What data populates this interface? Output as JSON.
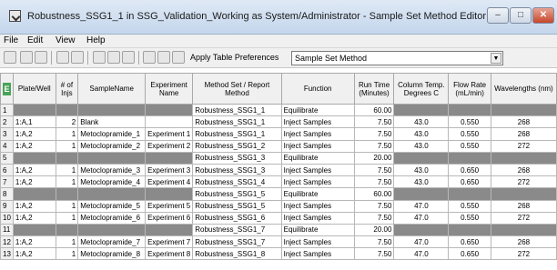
{
  "window": {
    "title": "Robustness_SSG1_1 in SSG_Validation_Working as System/Administrator - Sample Set Method Editor",
    "minimize": "–",
    "maximize": "□",
    "close": "✕"
  },
  "menu": [
    "File",
    "Edit",
    "View",
    "Help"
  ],
  "toolbar": {
    "apply_label": "Apply Table Preferences",
    "preference_value": "Sample Set Method",
    "dropdown_icon": "▼"
  },
  "table": {
    "corner": "E",
    "headers": [
      "Plate/Well",
      "# of Injs",
      "SampleName",
      "Experiment Name",
      "Method Set / Report Method",
      "Function",
      "Run Time (Minutes)",
      "Column Temp. Degrees C",
      "Flow Rate (mL/min)",
      "Wavelengths (nm)"
    ],
    "rows": [
      {
        "n": "1",
        "well": "",
        "injs": "",
        "name": "",
        "exp": "",
        "method": "Robustness_SSG1_1",
        "func": "Equilibrate",
        "time": "60.00",
        "temp": "",
        "flow": "",
        "wave": "",
        "gray": true
      },
      {
        "n": "2",
        "well": "1:A,1",
        "injs": "2",
        "name": "Blank",
        "exp": "",
        "method": "Robustness_SSG1_1",
        "func": "Inject Samples",
        "time": "7.50",
        "temp": "43.0",
        "flow": "0.550",
        "wave": "268",
        "gray": false
      },
      {
        "n": "3",
        "well": "1:A,2",
        "injs": "1",
        "name": "Metoclopramide_1",
        "exp": "Experiment 1",
        "method": "Robustness_SSG1_1",
        "func": "Inject Samples",
        "time": "7.50",
        "temp": "43.0",
        "flow": "0.550",
        "wave": "268",
        "gray": false
      },
      {
        "n": "4",
        "well": "1:A,2",
        "injs": "1",
        "name": "Metoclopramide_2",
        "exp": "Experiment 2",
        "method": "Robustness_SSG1_2",
        "func": "Inject Samples",
        "time": "7.50",
        "temp": "43.0",
        "flow": "0.550",
        "wave": "272",
        "gray": false
      },
      {
        "n": "5",
        "well": "",
        "injs": "",
        "name": "",
        "exp": "",
        "method": "Robustness_SSG1_3",
        "func": "Equilibrate",
        "time": "20.00",
        "temp": "",
        "flow": "",
        "wave": "",
        "gray": true
      },
      {
        "n": "6",
        "well": "1:A,2",
        "injs": "1",
        "name": "Metoclopramide_3",
        "exp": "Experiment 3",
        "method": "Robustness_SSG1_3",
        "func": "Inject Samples",
        "time": "7.50",
        "temp": "43.0",
        "flow": "0.650",
        "wave": "268",
        "gray": false
      },
      {
        "n": "7",
        "well": "1:A,2",
        "injs": "1",
        "name": "Metoclopramide_4",
        "exp": "Experiment 4",
        "method": "Robustness_SSG1_4",
        "func": "Inject Samples",
        "time": "7.50",
        "temp": "43.0",
        "flow": "0.650",
        "wave": "272",
        "gray": false
      },
      {
        "n": "8",
        "well": "",
        "injs": "",
        "name": "",
        "exp": "",
        "method": "Robustness_SSG1_5",
        "func": "Equilibrate",
        "time": "60.00",
        "temp": "",
        "flow": "",
        "wave": "",
        "gray": true
      },
      {
        "n": "9",
        "well": "1:A,2",
        "injs": "1",
        "name": "Metoclopramide_5",
        "exp": "Experiment 5",
        "method": "Robustness_SSG1_5",
        "func": "Inject Samples",
        "time": "7.50",
        "temp": "47.0",
        "flow": "0.550",
        "wave": "268",
        "gray": false
      },
      {
        "n": "10",
        "well": "1:A,2",
        "injs": "1",
        "name": "Metoclopramide_6",
        "exp": "Experiment 6",
        "method": "Robustness_SSG1_6",
        "func": "Inject Samples",
        "time": "7.50",
        "temp": "47.0",
        "flow": "0.550",
        "wave": "272",
        "gray": false
      },
      {
        "n": "11",
        "well": "",
        "injs": "",
        "name": "",
        "exp": "",
        "method": "Robustness_SSG1_7",
        "func": "Equilibrate",
        "time": "20.00",
        "temp": "",
        "flow": "",
        "wave": "",
        "gray": true
      },
      {
        "n": "12",
        "well": "1:A,2",
        "injs": "1",
        "name": "Metoclopramide_7",
        "exp": "Experiment 7",
        "method": "Robustness_SSG1_7",
        "func": "Inject Samples",
        "time": "7.50",
        "temp": "47.0",
        "flow": "0.650",
        "wave": "268",
        "gray": false
      },
      {
        "n": "13",
        "well": "1:A,2",
        "injs": "1",
        "name": "Metoclopramide_8",
        "exp": "Experiment 8",
        "method": "Robustness_SSG1_8",
        "func": "Inject Samples",
        "time": "7.50",
        "temp": "47.0",
        "flow": "0.650",
        "wave": "272",
        "gray": false
      }
    ]
  }
}
